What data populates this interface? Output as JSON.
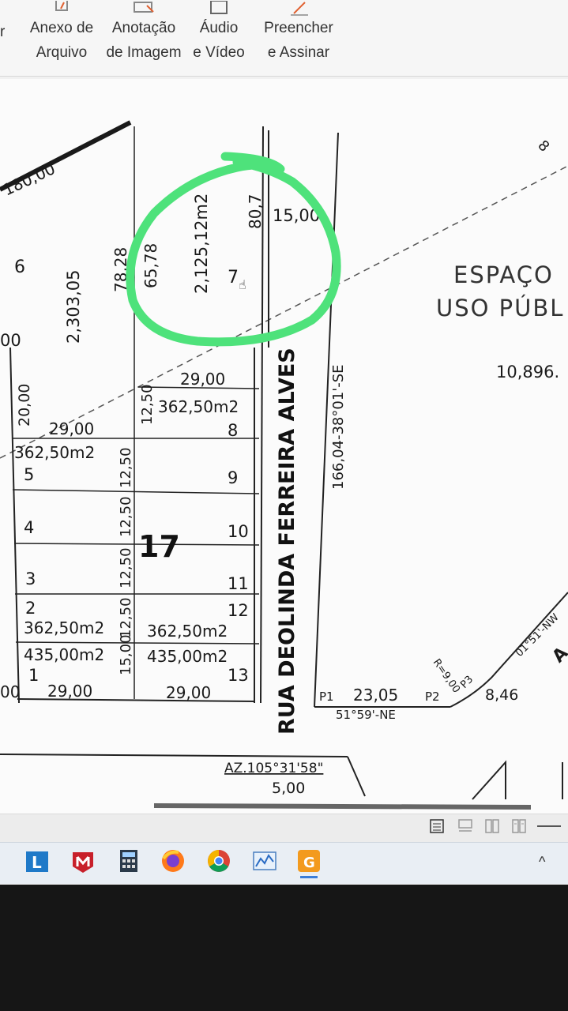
{
  "ribbon": {
    "cut_left": "r",
    "items": [
      {
        "line1": "Anexo de",
        "line2": "Arquivo",
        "icon": "paperclip-icon"
      },
      {
        "line1": "Anotação",
        "line2": "de Imagem",
        "icon": "image-annotation-icon"
      },
      {
        "line1": "Áudio",
        "line2": "e Vídeo",
        "icon": "media-icon"
      },
      {
        "line1": "Preencher",
        "line2": "e Assinar",
        "icon": "pen-sign-icon"
      }
    ]
  },
  "drawing": {
    "dimensions": {
      "d180": "180,00",
      "area6": "2,303,05",
      "d7828": "78,28",
      "d6578": "65,78",
      "area7": "2,125,12m2",
      "d807": "80,7",
      "d1500": "15,00",
      "left00": "00",
      "d2000": "20,00",
      "d2900a": "29,00",
      "d2900b": "29,00",
      "d1250": "12,50",
      "d1500v": "15,00",
      "d2900c": "29,00",
      "d2900d": "29,00",
      "bottom00": "00"
    },
    "lots": {
      "lot6": "6",
      "lot7": "7",
      "lot8": "8",
      "lot5": "5",
      "lot9": "9",
      "lot4": "4",
      "lot10": "10",
      "lot3": "3",
      "lot11": "11",
      "lot2": "2",
      "lot12": "12",
      "lot1": "1",
      "lot13": "13",
      "block": "17"
    },
    "areas": {
      "a8": "362,50m2",
      "a5": "362,50m2",
      "a2": "362,50m2",
      "a12": "362,50m2",
      "a1": "435,00m2",
      "a13": "435,00m2"
    },
    "street": "RUA DEOLINDA FERREIRA ALVES",
    "bearing_se": "166,04-38°01'-SE",
    "public_space_1": "ESPAÇO",
    "public_space_2": "USO PÚBL",
    "public_area": "10,896.",
    "p1": "P1",
    "p2": "P2",
    "p3": "P3",
    "d2305": "23,05",
    "bearing_ne": "51°59'-NE",
    "radius": "R=9,00",
    "d846": "8,46",
    "bearing_nw": "01°51'-NW",
    "corner_a": "A",
    "az": "AZ.105°31'58\"",
    "d500": "5,00",
    "edge_label": "8"
  },
  "status_icons": [
    "page-view-icon",
    "continuous-view-icon",
    "two-page-view-icon",
    "book-view-icon"
  ],
  "taskbar_icons": [
    "l-app-icon",
    "mcafee-icon",
    "calculator-icon",
    "firefox-icon",
    "chrome-icon",
    "chart-app-icon",
    "g-app-icon"
  ],
  "colors": {
    "highlight": "#4ee27b",
    "ink": "#1a1a1a"
  }
}
